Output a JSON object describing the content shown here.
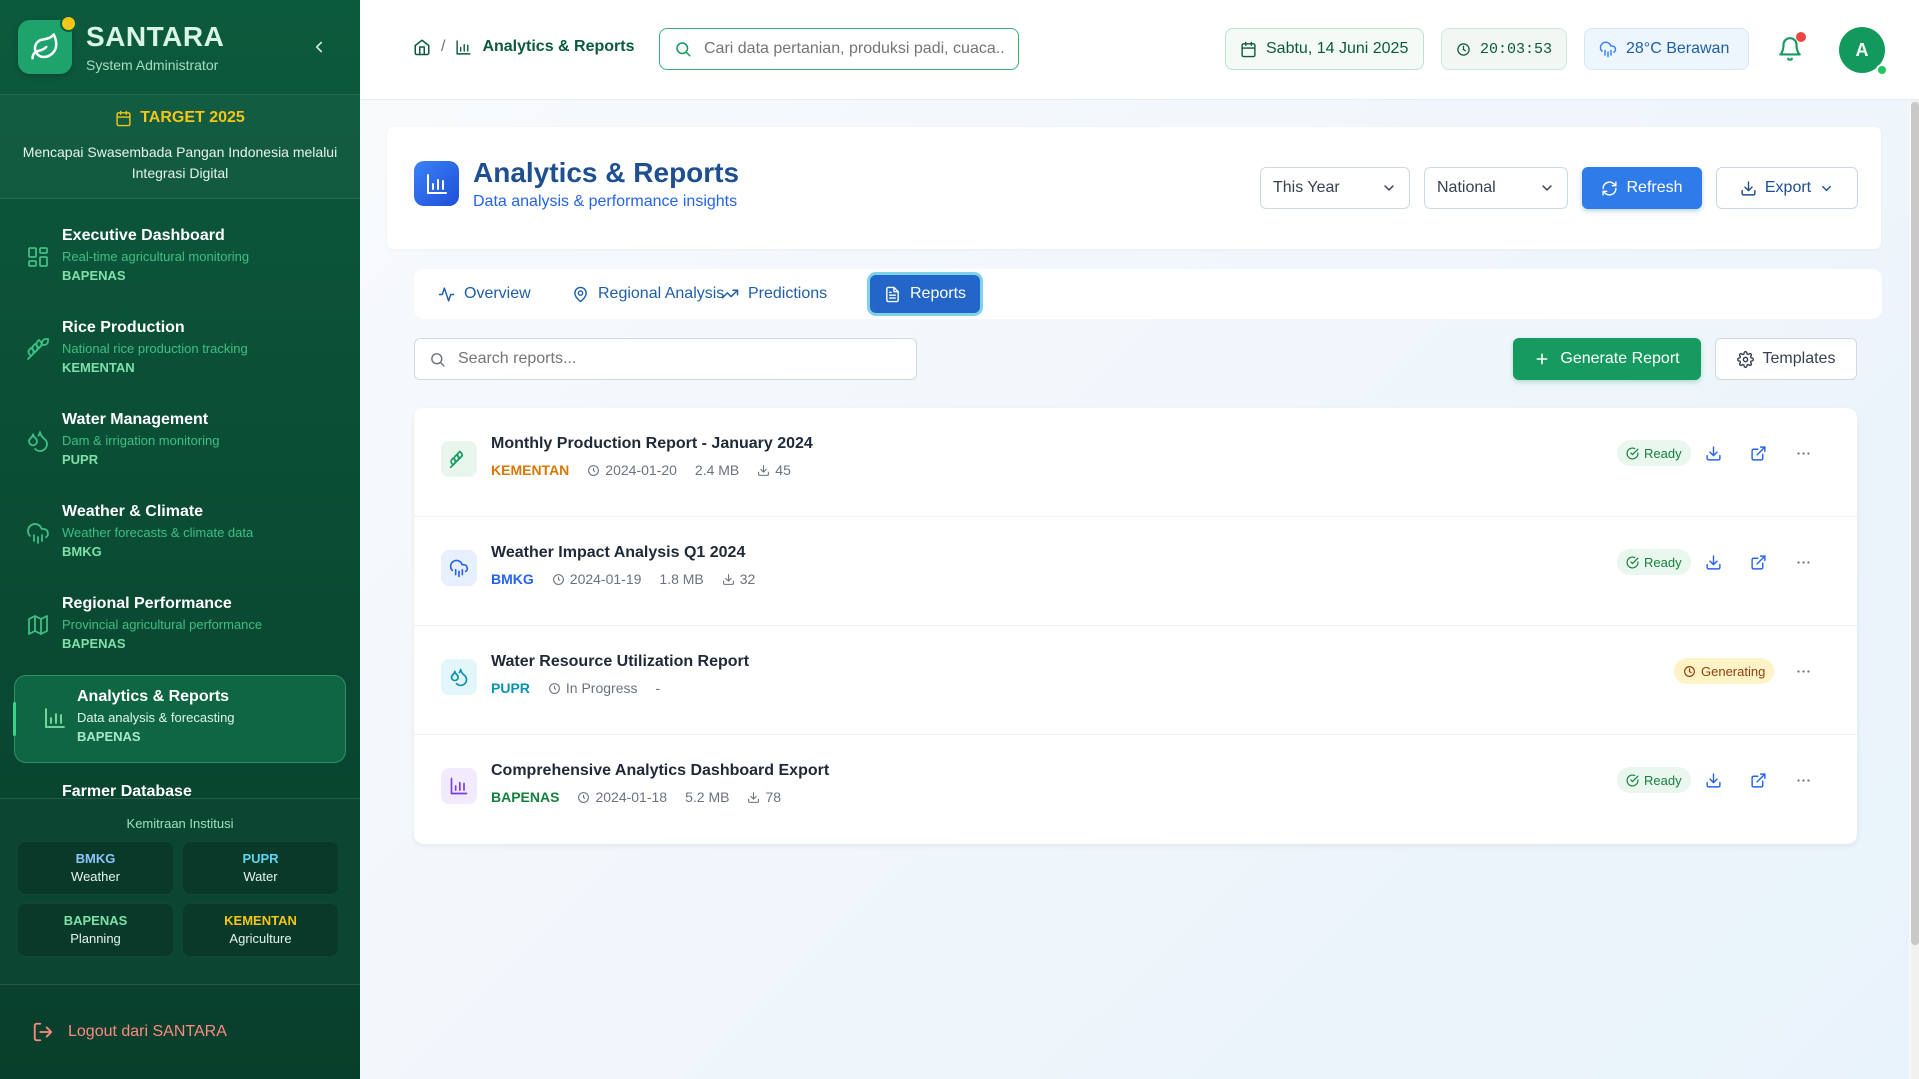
{
  "sidebar": {
    "brand_name": "SANTARA",
    "brand_role": "System Administrator",
    "target_title": "TARGET 2025",
    "target_desc": "Mencapai Swasembada Pangan Indonesia melalui Integrasi Digital",
    "items": [
      {
        "title": "Executive Dashboard",
        "sub": "Real-time agricultural monitoring",
        "org": "BAPENAS",
        "icon": "grid-icon"
      },
      {
        "title": "Rice Production",
        "sub": "National rice production tracking",
        "org": "KEMENTAN",
        "icon": "wheat-icon"
      },
      {
        "title": "Water Management",
        "sub": "Dam & irrigation monitoring",
        "org": "PUPR",
        "icon": "droplets-icon"
      },
      {
        "title": "Weather & Climate",
        "sub": "Weather forecasts & climate data",
        "org": "BMKG",
        "icon": "cloud-rain-icon"
      },
      {
        "title": "Regional Performance",
        "sub": "Provincial agricultural performance",
        "org": "BAPENAS",
        "icon": "map-icon"
      },
      {
        "title": "Analytics & Reports",
        "sub": "Data analysis & forecasting",
        "org": "BAPENAS",
        "icon": "bar-chart-icon"
      },
      {
        "title": "Farmer Database",
        "sub": "",
        "org": "",
        "icon": "users-icon"
      }
    ],
    "partners_title": "Kemitraan Institusi",
    "partners": [
      {
        "code": "BMKG",
        "label": "Weather",
        "color": "#8ec5ff"
      },
      {
        "code": "PUPR",
        "label": "Water",
        "color": "#5fd4f0"
      },
      {
        "code": "BAPENAS",
        "label": "Planning",
        "color": "#7fe0aa"
      },
      {
        "code": "KEMENTAN",
        "label": "Agriculture",
        "color": "#f5c518"
      }
    ],
    "logout_label": "Logout dari SANTARA"
  },
  "topbar": {
    "breadcrumb_sep": "/",
    "breadcrumb_current": "Analytics & Reports",
    "search_placeholder": "Cari data pertanian, produksi padi, cuaca...",
    "date": "Sabtu, 14 Juni 2025",
    "time": "20:03:53",
    "weather": "28°C Berawan",
    "avatar_initial": "A"
  },
  "page": {
    "title": "Analytics & Reports",
    "subtitle": "Data analysis & performance insights",
    "period_select": "This Year",
    "scope_select": "National",
    "refresh_label": "Refresh",
    "export_label": "Export"
  },
  "tabs": [
    {
      "label": "Overview",
      "icon": "activity-icon"
    },
    {
      "label": "Regional Analysis",
      "icon": "map-pin-icon"
    },
    {
      "label": "Predictions",
      "icon": "trending-up-icon"
    },
    {
      "label": "Reports",
      "icon": "file-text-icon",
      "active": true
    }
  ],
  "reports_toolbar": {
    "search_placeholder": "Search reports...",
    "generate_label": "Generate Report",
    "templates_label": "Templates"
  },
  "reports": [
    {
      "title": "Monthly Production Report - January 2024",
      "org": "KEMENTAN",
      "org_color": "#d97706",
      "date": "2024-01-20",
      "size": "2.4 MB",
      "downloads": "45",
      "status": "Ready",
      "icon": "wheat-icon"
    },
    {
      "title": "Weather Impact Analysis Q1 2024",
      "org": "BMKG",
      "org_color": "#2563eb",
      "date": "2024-01-19",
      "size": "1.8 MB",
      "downloads": "32",
      "status": "Ready",
      "icon": "cloud-rain-icon"
    },
    {
      "title": "Water Resource Utilization Report",
      "org": "PUPR",
      "org_color": "#0891b2",
      "date": "In Progress",
      "size": "-",
      "downloads": "",
      "status": "Generating",
      "icon": "droplets-icon"
    },
    {
      "title": "Comprehensive Analytics Dashboard Export",
      "org": "BAPENAS",
      "org_color": "#15803d",
      "date": "2024-01-18",
      "size": "5.2 MB",
      "downloads": "78",
      "status": "Ready",
      "icon": "bar-chart-icon"
    }
  ]
}
